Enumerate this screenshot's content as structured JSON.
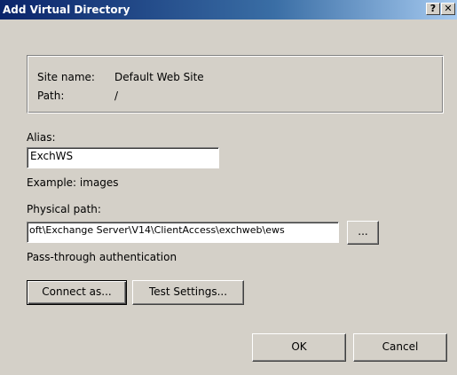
{
  "window": {
    "title": "Add Virtual Directory",
    "help_button": "?",
    "close_button": "✕"
  },
  "site_info": {
    "site_name_label": "Site name:",
    "site_name_value": "Default Web Site",
    "path_label": "Path:",
    "path_value": "/"
  },
  "alias": {
    "label": "Alias:",
    "value": "ExchWS",
    "example": "Example: images"
  },
  "physical_path": {
    "label": "Physical path:",
    "value": "oft\\Exchange Server\\V14\\ClientAccess\\exchweb\\ews",
    "browse_button": "..."
  },
  "auth": {
    "label": "Pass-through authentication",
    "connect_as_button": "Connect as...",
    "test_settings_button": "Test Settings..."
  },
  "footer": {
    "ok_button": "OK",
    "cancel_button": "Cancel"
  },
  "colors": {
    "title_bar_start": "#0a246a",
    "title_bar_end": "#a6caf0",
    "dialog_face": "#d4d0c8"
  }
}
